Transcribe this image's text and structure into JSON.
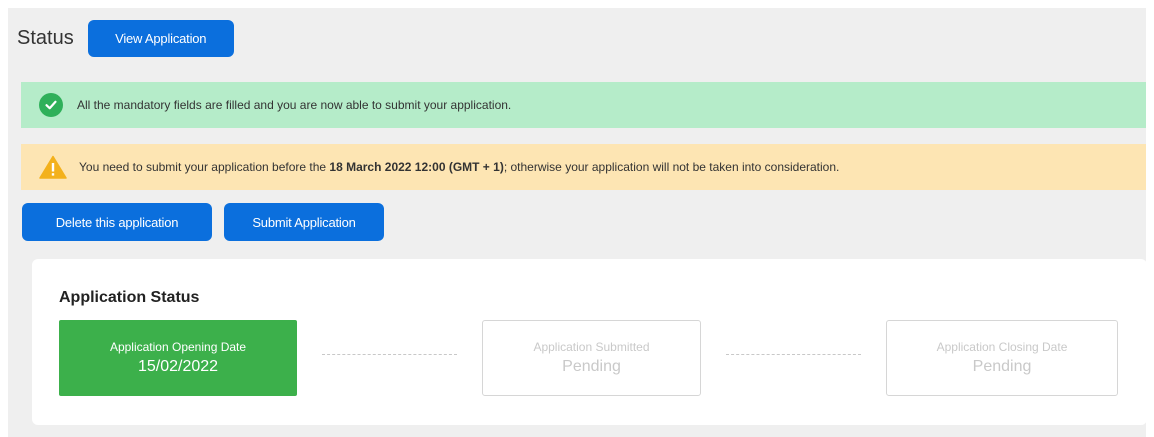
{
  "header": {
    "title": "Status",
    "view_button": "View Application"
  },
  "alerts": {
    "success": {
      "icon": "check-circle-icon",
      "text": "All the mandatory fields are filled and you are now able to submit your application."
    },
    "warning": {
      "icon": "warning-triangle-icon",
      "text_before": "You need to submit your application before the ",
      "deadline": "18 March 2022 12:00 (GMT + 1)",
      "text_after": "; otherwise your application will not be taken into consideration."
    }
  },
  "actions": {
    "delete_label": "Delete this application",
    "submit_label": "Submit Application"
  },
  "status_card": {
    "title": "Application Status",
    "steps": [
      {
        "label": "Application Opening Date",
        "value": "15/02/2022",
        "state": "complete"
      },
      {
        "label": "Application Submitted",
        "value": "Pending",
        "state": "pending"
      },
      {
        "label": "Application Closing Date",
        "value": "Pending",
        "state": "pending"
      }
    ]
  },
  "colors": {
    "primary": "#0b6fdd",
    "success_bg": "#b5ecc9",
    "warning_bg": "#fde5b3",
    "step_complete": "#3cb04b",
    "step_pending_text": "#c9c9c9"
  }
}
